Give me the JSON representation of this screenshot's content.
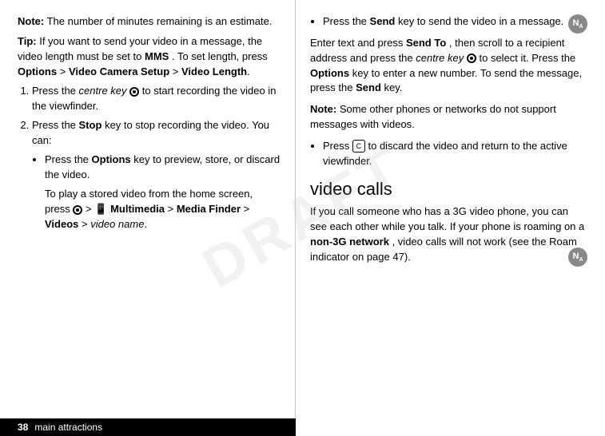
{
  "page": {
    "number": "38",
    "label": "main attractions"
  },
  "left": {
    "note1": {
      "label": "Note:",
      "text": "The number of minutes remaining is an estimate."
    },
    "tip": {
      "label": "Tip:",
      "text1": "If you want to send your video in a message, the video length must be set to",
      "mms": "MMS",
      "text2": ". To set length, press",
      "nav": "Options",
      "arrow": ">",
      "bold1": "Video Camera Setup",
      "arrow2": ">",
      "bold2": "Video Length",
      "period": "."
    },
    "steps": [
      {
        "num": "1",
        "text1": "Press the",
        "italic": "centre key",
        "dot": "·",
        "text2": "to start recording the video in the viewfinder."
      },
      {
        "num": "2",
        "text1": "Press the",
        "bold": "Stop",
        "text2": "key to stop recording the video. You can:"
      }
    ],
    "bullets": [
      {
        "text1": "Press the",
        "bold": "Options",
        "text2": "key to preview, store, or discard the video."
      }
    ],
    "indent_para": {
      "text1": "To play a stored video from the home screen, press",
      "dot": "·",
      "arrow": ">",
      "multimedia": "Multimedia",
      "arrow2": ">",
      "media_finder": "Media Finder",
      "arrow3": ">",
      "videos": "Videos",
      "arrow4": ">",
      "video_name": "video name",
      "period": "."
    }
  },
  "right": {
    "bullet1": {
      "text1": "Press the",
      "bold": "Send",
      "text2": "key to send the video in a message."
    },
    "para1": {
      "text1": "Enter text and press",
      "bold1": "Send To",
      "text2": ", then scroll to a recipient address and press the",
      "italic": "centre key",
      "dot": "·",
      "text3": "to select it. Press the",
      "bold2": "Options",
      "text4": "key to enter a new number. To send the message, press the",
      "bold3": "Send",
      "text5": "key."
    },
    "note2": {
      "label": "Note:",
      "text": "Some other phones or networks do not support messages with videos."
    },
    "bullet2": {
      "text1": "Press",
      "icon": "C",
      "text2": "to discard the video and return to the active viewfinder."
    },
    "section_title": "video calls",
    "section_para": {
      "text1": "If you call someone who has a 3G video phone, you can see each other while you talk. If your phone is roaming on a",
      "bold": "non-3G network",
      "text2": ", video calls will not work (see the Roam indicator on page 47)."
    }
  },
  "watermark": "DRAFT"
}
